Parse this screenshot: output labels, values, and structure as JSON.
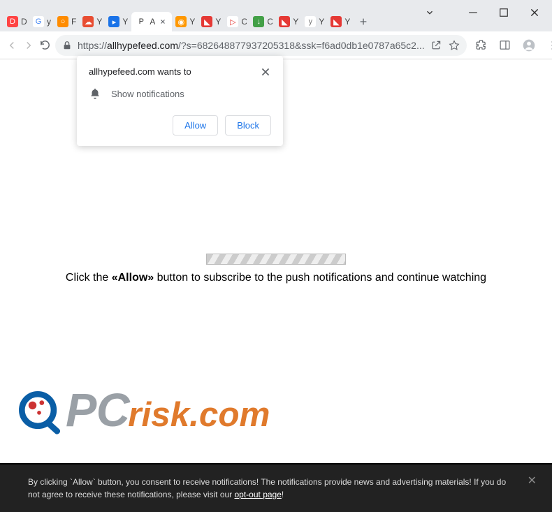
{
  "window": {
    "minimize": "–",
    "maximize": "▢",
    "close": "✕"
  },
  "tabs": [
    {
      "favicon_bg": "#ff4444",
      "favicon_fg": "#fff",
      "glyph": "D",
      "title": "D"
    },
    {
      "favicon_bg": "#fff",
      "favicon_fg": "#4285f4",
      "glyph": "G",
      "title": "y"
    },
    {
      "favicon_bg": "#ff8c00",
      "favicon_fg": "#fff",
      "glyph": "○",
      "title": "F"
    },
    {
      "favicon_bg": "#e84d32",
      "favicon_fg": "#fff",
      "glyph": "☁",
      "title": "Y"
    },
    {
      "favicon_bg": "#1a73e8",
      "favicon_fg": "#fff",
      "glyph": "▸",
      "title": "Y"
    },
    {
      "favicon_bg": "#fff",
      "favicon_fg": "#333",
      "glyph": "P",
      "title": "A",
      "active": true
    },
    {
      "favicon_bg": "#ff9800",
      "favicon_fg": "#fff",
      "glyph": "◉",
      "title": "Y"
    },
    {
      "favicon_bg": "#e53935",
      "favicon_fg": "#fff",
      "glyph": "◣",
      "title": "Y"
    },
    {
      "favicon_bg": "#fff",
      "favicon_fg": "#e53935",
      "glyph": "▷",
      "title": "C"
    },
    {
      "favicon_bg": "#43a047",
      "favicon_fg": "#fff",
      "glyph": "↓",
      "title": "C"
    },
    {
      "favicon_bg": "#e53935",
      "favicon_fg": "#fff",
      "glyph": "◣",
      "title": "Y"
    },
    {
      "favicon_bg": "#fff",
      "favicon_fg": "#777",
      "glyph": "y",
      "title": "Y"
    },
    {
      "favicon_bg": "#e53935",
      "favicon_fg": "#fff",
      "glyph": "◣",
      "title": "Y"
    }
  ],
  "addressbar": {
    "scheme": "https://",
    "host": "allhypefeed.com",
    "path": "/?s=682648877937205318&ssk=f6ad0db1e0787a65c2..."
  },
  "permission": {
    "title": "allhypefeed.com wants to",
    "request": "Show notifications",
    "allow": "Allow",
    "block": "Block"
  },
  "page": {
    "instruction_pre": "Click the ",
    "instruction_bold": "«Allow»",
    "instruction_post": " button to subscribe to the push notifications and continue watching"
  },
  "consent": {
    "text_pre": "By clicking `Allow` button, you consent to receive notifications! The notifications provide news and advertising materials! If you do not agree to receive these notifications, please visit our ",
    "link": "opt-out page",
    "text_post": "!"
  },
  "logo": {
    "p": "P",
    "c": "C",
    "suffix": "risk.com"
  }
}
